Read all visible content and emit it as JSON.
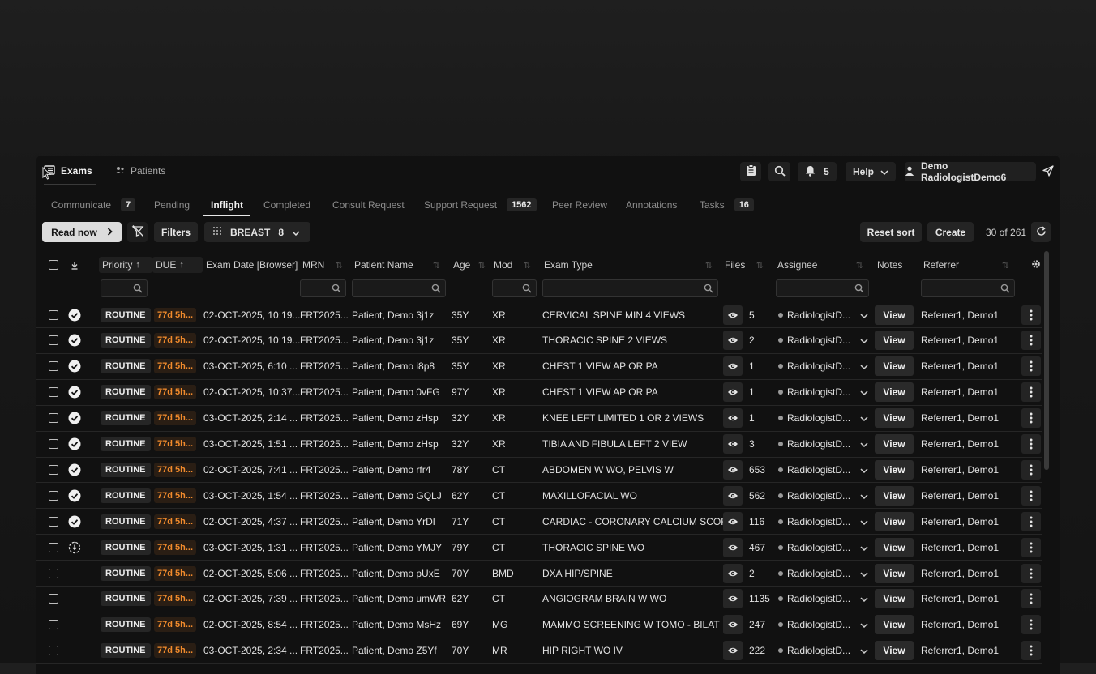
{
  "nav": {
    "exams": "Exams",
    "patients": "Patients"
  },
  "topbar": {
    "notifications_count": "5",
    "help": "Help",
    "user": "Demo RadiologistDemo6"
  },
  "subtabs": [
    {
      "label": "Communicate",
      "badge": "7"
    },
    {
      "label": "Pending",
      "badge": ""
    },
    {
      "label": "Inflight",
      "badge": ""
    },
    {
      "label": "Completed",
      "badge": ""
    },
    {
      "label": "Consult Request",
      "badge": ""
    },
    {
      "label": "Support Request",
      "badge": "1562"
    },
    {
      "label": "Peer Review",
      "badge": ""
    },
    {
      "label": "Annotations",
      "badge": ""
    },
    {
      "label": "Tasks",
      "badge": "16"
    }
  ],
  "active_subtab": "Inflight",
  "toolbar": {
    "read_now": "Read now",
    "filters": "Filters",
    "worklist": "BREAST",
    "worklist_count": "8",
    "reset_sort": "Reset sort",
    "create": "Create",
    "count": "30 of 261"
  },
  "columns": {
    "priority": "Priority",
    "due": "DUE",
    "exam_date": "Exam Date [Browser]",
    "mrn": "MRN",
    "patient_name": "Patient Name",
    "age": "Age",
    "mod": "Mod",
    "exam_type": "Exam Type",
    "files": "Files",
    "assignee": "Assignee",
    "notes": "Notes",
    "referrer": "Referrer"
  },
  "colors": {
    "due_text": "#f28b2c",
    "background": "#111111",
    "accent": "#dcdcdc"
  },
  "rows": [
    {
      "status": "done",
      "priority": "ROUTINE",
      "due": "77d 5h...",
      "exam_date": "02-OCT-2025, 10:19...",
      "mrn": "FRT2025...",
      "patient": "Patient, Demo 3j1z",
      "age": "35Y",
      "mod": "XR",
      "exam_type": "CERVICAL SPINE MIN 4 VIEWS",
      "files": "5",
      "assignee": "RadiologistD...",
      "notes": "View",
      "referrer": "Referrer1, Demo1"
    },
    {
      "status": "done",
      "priority": "ROUTINE",
      "due": "77d 5h...",
      "exam_date": "02-OCT-2025, 10:19...",
      "mrn": "FRT2025...",
      "patient": "Patient, Demo 3j1z",
      "age": "35Y",
      "mod": "XR",
      "exam_type": "THORACIC SPINE 2 VIEWS",
      "files": "2",
      "assignee": "RadiologistD...",
      "notes": "View",
      "referrer": "Referrer1, Demo1"
    },
    {
      "status": "done",
      "priority": "ROUTINE",
      "due": "77d 5h...",
      "exam_date": "03-OCT-2025, 6:10 ...",
      "mrn": "FRT2025...",
      "patient": "Patient, Demo i8p8",
      "age": "35Y",
      "mod": "XR",
      "exam_type": "CHEST 1 VIEW AP OR PA",
      "files": "1",
      "assignee": "RadiologistD...",
      "notes": "View",
      "referrer": "Referrer1, Demo1"
    },
    {
      "status": "done",
      "priority": "ROUTINE",
      "due": "77d 5h...",
      "exam_date": "02-OCT-2025, 10:37...",
      "mrn": "FRT2025...",
      "patient": "Patient, Demo 0vFG",
      "age": "97Y",
      "mod": "XR",
      "exam_type": "CHEST 1 VIEW AP OR PA",
      "files": "1",
      "assignee": "RadiologistD...",
      "notes": "View",
      "referrer": "Referrer1, Demo1"
    },
    {
      "status": "done",
      "priority": "ROUTINE",
      "due": "77d 5h...",
      "exam_date": "03-OCT-2025, 2:14 ...",
      "mrn": "FRT2025...",
      "patient": "Patient, Demo zHsp",
      "age": "32Y",
      "mod": "XR",
      "exam_type": "KNEE LEFT LIMITED 1 OR 2 VIEWS",
      "files": "1",
      "assignee": "RadiologistD...",
      "notes": "View",
      "referrer": "Referrer1, Demo1"
    },
    {
      "status": "done",
      "priority": "ROUTINE",
      "due": "77d 5h...",
      "exam_date": "03-OCT-2025, 1:51 ...",
      "mrn": "FRT2025...",
      "patient": "Patient, Demo zHsp",
      "age": "32Y",
      "mod": "XR",
      "exam_type": "TIBIA AND FIBULA LEFT 2 VIEW",
      "files": "3",
      "assignee": "RadiologistD...",
      "notes": "View",
      "referrer": "Referrer1, Demo1"
    },
    {
      "status": "done",
      "priority": "ROUTINE",
      "due": "77d 5h...",
      "exam_date": "02-OCT-2025, 7:41 ...",
      "mrn": "FRT2025...",
      "patient": "Patient, Demo rfr4",
      "age": "78Y",
      "mod": "CT",
      "exam_type": "ABDOMEN W WO, PELVIS W",
      "files": "653",
      "assignee": "RadiologistD...",
      "notes": "View",
      "referrer": "Referrer1, Demo1"
    },
    {
      "status": "done",
      "priority": "ROUTINE",
      "due": "77d 5h...",
      "exam_date": "03-OCT-2025, 1:54 ...",
      "mrn": "FRT2025...",
      "patient": "Patient, Demo GQLJ",
      "age": "62Y",
      "mod": "CT",
      "exam_type": "MAXILLOFACIAL WO",
      "files": "562",
      "assignee": "RadiologistD...",
      "notes": "View",
      "referrer": "Referrer1, Demo1"
    },
    {
      "status": "done",
      "priority": "ROUTINE",
      "due": "77d 5h...",
      "exam_date": "02-OCT-2025, 4:37 ...",
      "mrn": "FRT2025...",
      "patient": "Patient, Demo YrDl",
      "age": "71Y",
      "mod": "CT",
      "exam_type": "CARDIAC - CORONARY CALCIUM SCORI...",
      "files": "116",
      "assignee": "RadiologistD...",
      "notes": "View",
      "referrer": "Referrer1, Demo1"
    },
    {
      "status": "downloading",
      "priority": "ROUTINE",
      "due": "77d 5h...",
      "exam_date": "03-OCT-2025, 1:31 ...",
      "mrn": "FRT2025...",
      "patient": "Patient, Demo YMJY",
      "age": "79Y",
      "mod": "CT",
      "exam_type": "THORACIC SPINE WO",
      "files": "467",
      "assignee": "RadiologistD...",
      "notes": "View",
      "referrer": "Referrer1, Demo1"
    },
    {
      "status": "none",
      "priority": "ROUTINE",
      "due": "77d 5h...",
      "exam_date": "02-OCT-2025, 5:06 ...",
      "mrn": "FRT2025...",
      "patient": "Patient, Demo pUxE",
      "age": "70Y",
      "mod": "BMD",
      "exam_type": "DXA HIP/SPINE",
      "files": "2",
      "assignee": "RadiologistD...",
      "notes": "View",
      "referrer": "Referrer1, Demo1"
    },
    {
      "status": "none",
      "priority": "ROUTINE",
      "due": "77d 5h...",
      "exam_date": "02-OCT-2025, 7:39 ...",
      "mrn": "FRT2025...",
      "patient": "Patient, Demo umWR",
      "age": "62Y",
      "mod": "CT",
      "exam_type": "ANGIOGRAM BRAIN W WO",
      "files": "1135",
      "assignee": "RadiologistD...",
      "notes": "View",
      "referrer": "Referrer1, Demo1"
    },
    {
      "status": "none",
      "priority": "ROUTINE",
      "due": "77d 5h...",
      "exam_date": "02-OCT-2025, 8:54 ...",
      "mrn": "FRT2025...",
      "patient": "Patient, Demo MsHz",
      "age": "69Y",
      "mod": "MG",
      "exam_type": "MAMMO SCREENING W TOMO - BILAT",
      "files": "247",
      "assignee": "RadiologistD...",
      "notes": "View",
      "referrer": "Referrer1, Demo1"
    },
    {
      "status": "none",
      "priority": "ROUTINE",
      "due": "77d 5h...",
      "exam_date": "03-OCT-2025, 2:34 ...",
      "mrn": "FRT2025...",
      "patient": "Patient, Demo Z5Yf",
      "age": "70Y",
      "mod": "MR",
      "exam_type": "HIP RIGHT WO IV",
      "files": "222",
      "assignee": "RadiologistD...",
      "notes": "View",
      "referrer": "Referrer1, Demo1"
    }
  ]
}
